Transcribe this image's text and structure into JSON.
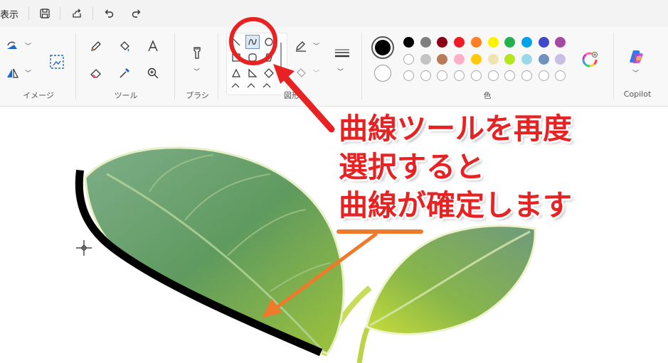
{
  "menu": {
    "view": "表示"
  },
  "ribbon": {
    "groups": {
      "image": "イメージ",
      "tools": "ツール",
      "brushes": "ブラシ",
      "shapes": "図形",
      "colors": "色",
      "copilot": "Copilot"
    }
  },
  "palette": {
    "primary": "#000000",
    "secondary": "#ffffff",
    "row1": [
      "#000000",
      "#7f7f7f",
      "#880015",
      "#ed1c24",
      "#ff7f27",
      "#fff200",
      "#22b14c",
      "#00a2e8",
      "#3f48cc",
      "#a349a4"
    ],
    "row2": [
      "#ffffff",
      "#c3c3c3",
      "#b97a57",
      "#ffaec9",
      "#ffc90e",
      "#efe4b0",
      "#b5e61d",
      "#99d9ea",
      "#7092be",
      "#c8bfe7"
    ]
  },
  "annotation": {
    "line1": "曲線ツールを再度",
    "line2": "選択すると",
    "line3": "曲線が確定します",
    "text_color": "#e82222",
    "arrow_color": "#f07a2c"
  },
  "icons": [
    "save-icon",
    "share-icon",
    "undo-icon",
    "redo-icon",
    "rotate-icon",
    "flip-icon",
    "resize-icon",
    "pencil-icon",
    "fill-icon",
    "text-icon",
    "eraser-icon",
    "color-picker-icon",
    "magnifier-icon",
    "brush-icon",
    "line-shape-icon",
    "curve-shape-icon",
    "oval-shape-icon",
    "rectangle-shape-icon",
    "outline-icon",
    "fill-shape-icon",
    "stroke-size-icon",
    "edit-colors-icon",
    "copilot-icon"
  ]
}
